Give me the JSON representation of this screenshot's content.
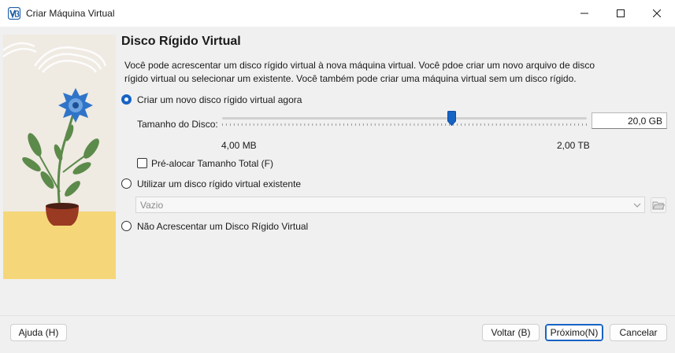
{
  "window": {
    "title": "Criar Máquina Virtual",
    "app_icon": "virtualbox-icon",
    "controls": [
      "minimize-icon",
      "maximize-icon",
      "close-icon"
    ]
  },
  "page": {
    "heading": "Disco Rígido Virtual",
    "description_line1": "Você pode acrescentar um disco rígido virtual à nova máquina virtual. Você pdoe criar um novo arquivo de disco",
    "description_line2": "rígido virtual ou selecionar um existente. Você também pode criar uma máquina virtual sem um disco rígido."
  },
  "options": {
    "create_new": {
      "label": "Criar um novo disco rígido virtual agora",
      "checked": true
    },
    "size": {
      "label": "Tamanho do Disco:",
      "value": "20,0 GB",
      "min_label": "4,00 MB",
      "max_label": "2,00 TB",
      "slider_fraction": 0.63
    },
    "preallocate": {
      "label": "Pré-alocar Tamanho Total (F)",
      "checked": false
    },
    "use_existing": {
      "label": "Utilizar um disco rígido virtual existente",
      "checked": false
    },
    "existing_combo": {
      "value": "Vazio",
      "icon": "chevron-down-icon"
    },
    "folder_icon": "folder-open-icon",
    "no_disk": {
      "label": "Não Acrescentar um Disco Rígido Virtual",
      "checked": false
    }
  },
  "footer": {
    "help": "Ajuda (H)",
    "back": "Voltar (B)",
    "next": "Próximo(N)",
    "cancel": "Cancelar"
  },
  "colors": {
    "accent": "#1763c4",
    "illustration_floor": "#f5d77a",
    "flower": "#2f74c9",
    "pot": "#9a3a22",
    "leaves": "#5c8a4a"
  }
}
